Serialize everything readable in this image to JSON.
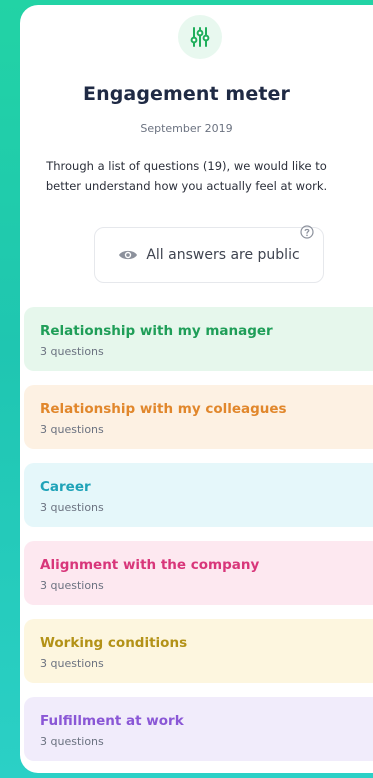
{
  "header": {
    "title": "Engagement meter",
    "subtitle": "September 2019",
    "description_lines": [
      "Through a list of questions (19), we would like to",
      "better understand how you actually feel at work."
    ],
    "public_notice": "All answers are public",
    "icon": "sliders-icon",
    "accent": "#1fae5b"
  },
  "sections": [
    {
      "title": "Relationship with my manager",
      "count": "3 questions",
      "text_color": "#1f9e58",
      "bg_color": "#e6f7ec"
    },
    {
      "title": "Relationship with my colleagues",
      "count": "3 questions",
      "text_color": "#e1872c",
      "bg_color": "#fdf1e3"
    },
    {
      "title": "Career",
      "count": "3 questions",
      "text_color": "#1fa3b8",
      "bg_color": "#e5f7fa"
    },
    {
      "title": "Alignment with the company",
      "count": "3 questions",
      "text_color": "#d8367a",
      "bg_color": "#fde8f0"
    },
    {
      "title": "Working conditions",
      "count": "3 questions",
      "text_color": "#b39217",
      "bg_color": "#fdf6df"
    },
    {
      "title": "Fulfillment at work",
      "count": "3 questions",
      "text_color": "#8a57d6",
      "bg_color": "#f1ecfb"
    }
  ]
}
